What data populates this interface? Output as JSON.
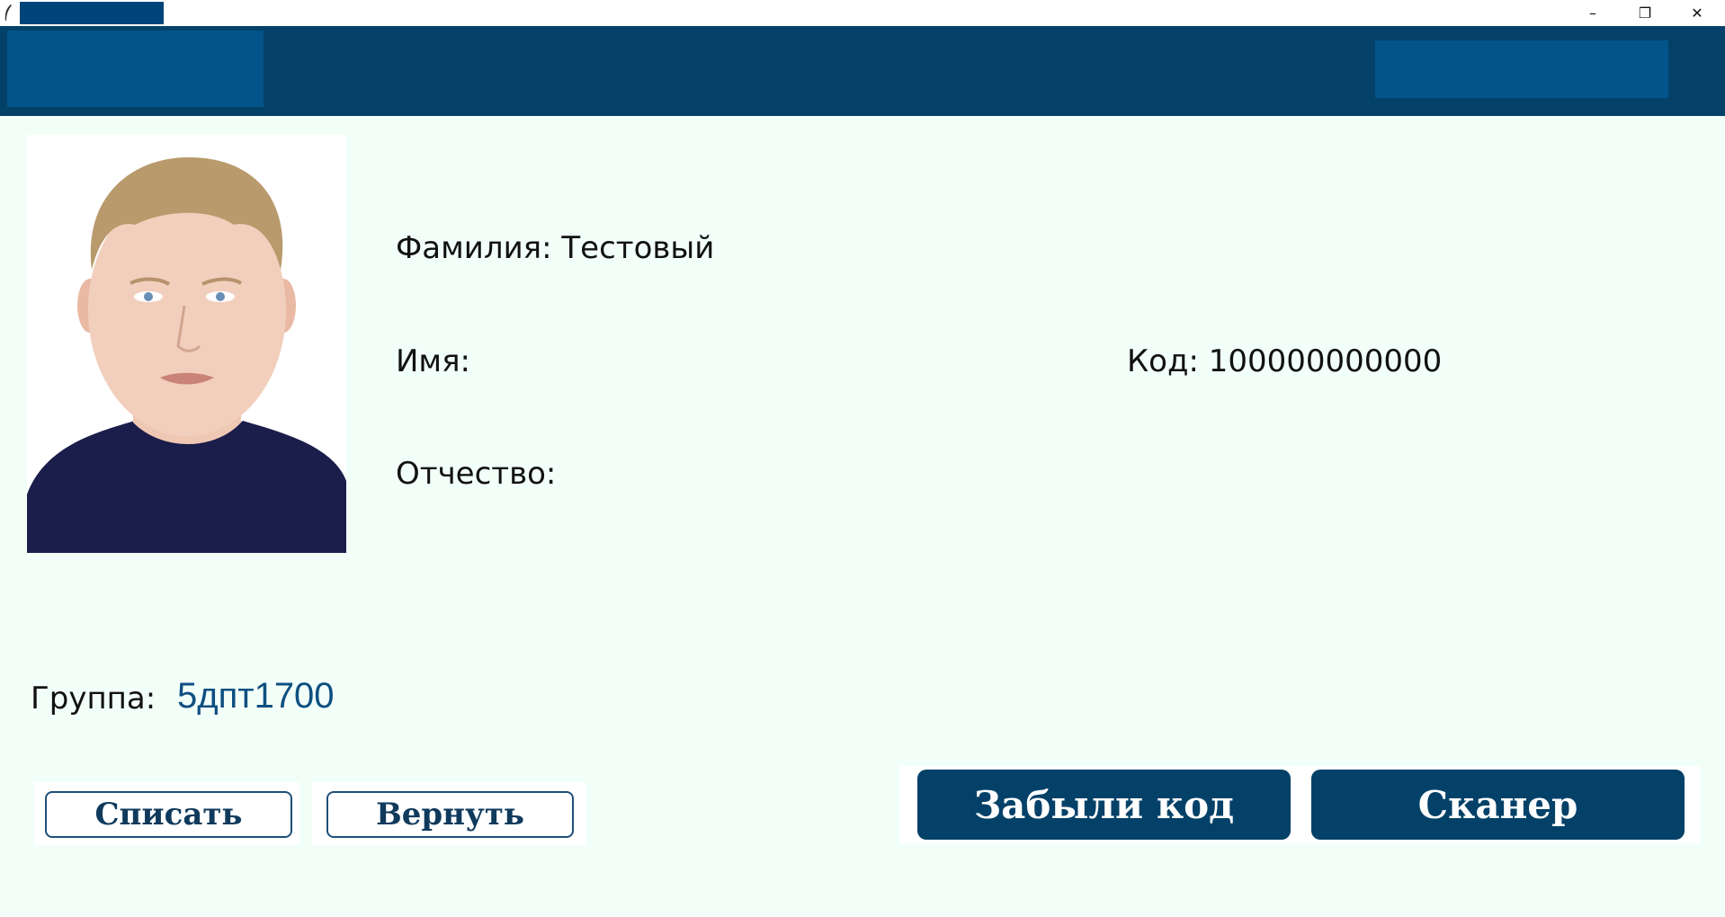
{
  "window": {
    "icon": "feather-icon",
    "controls": {
      "minimize": "–",
      "restore": "❐",
      "close": "✕"
    }
  },
  "colors": {
    "header": "#034168",
    "header_block": "#03548a",
    "background": "#f2fff9",
    "accent_text": "#0e4f80"
  },
  "student": {
    "surname_label": "Фамилия: Тестовый",
    "name_label": "Имя:",
    "patronymic_label": "Отчество:",
    "code_label": "Код: 100000000000",
    "group_label": "Группа:",
    "group_value": "5дпт1700"
  },
  "actions": {
    "write_off": "Списать",
    "return": "Вернуть",
    "forgot_code": "Забыли код",
    "scanner": "Сканер"
  }
}
